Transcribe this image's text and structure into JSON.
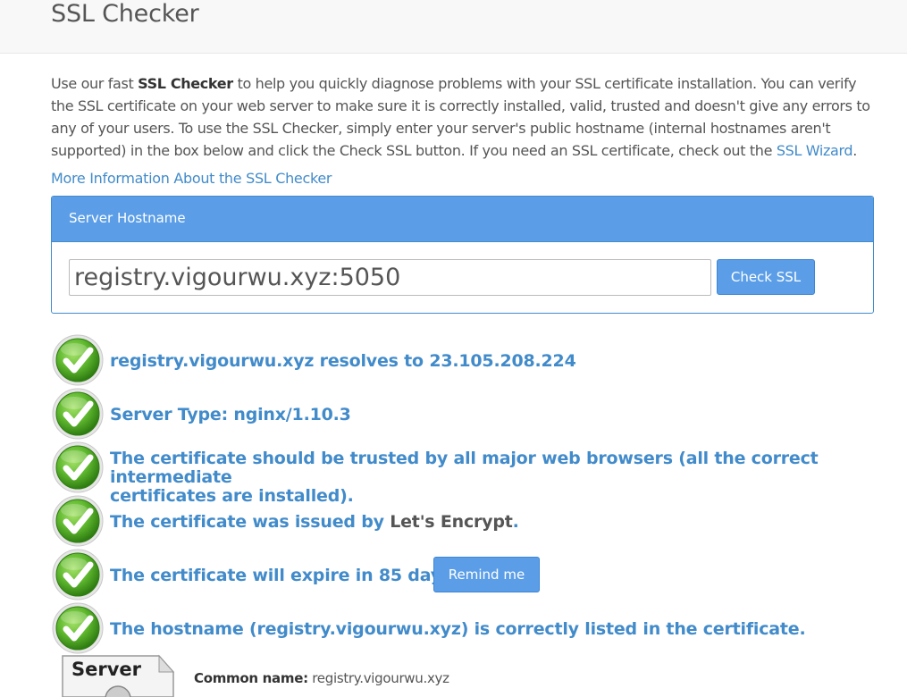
{
  "header": {
    "title": "SSL Checker"
  },
  "intro": {
    "before_bold": "Use our fast ",
    "bold": "SSL Checker",
    "after_bold": " to help you quickly diagnose problems with your SSL certificate installation. You can verify the SSL certificate on your web server to make sure it is correctly installed, valid, trusted and doesn't give any errors to any of your users. To use the SSL Checker, simply enter your server's public hostname (internal hostnames aren't supported) in the box below and click the Check SSL button. If you need an SSL certificate, check out the ",
    "link": "SSL Wizard",
    "end": "."
  },
  "more_info_link": "More Information About the SSL Checker",
  "form": {
    "heading": "Server Hostname",
    "hostname_value": "registry.vigourwu.xyz:5050",
    "check_button": "Check SSL"
  },
  "results": [
    {
      "text": "registry.vigourwu.xyz resolves to 23.105.208.224"
    },
    {
      "text": "Server Type: nginx/1.10.3"
    },
    {
      "line1": "The certificate should be trusted by all major web browsers (all the correct intermediate",
      "line2": "certificates are installed)."
    },
    {
      "prefix": "The certificate was issued by ",
      "issuer": "Let's Encrypt",
      "suffix": "."
    },
    {
      "text": "The certificate will expire in 85 days.",
      "button": "Remind me"
    },
    {
      "text": "The hostname (registry.vigourwu.xyz) is correctly listed in the certificate."
    }
  ],
  "server_image_label": "Server",
  "cert": {
    "common_name_label": "Common name:",
    "common_name_value": " registry.vigourwu.xyz"
  },
  "colors": {
    "accent": "#428bca",
    "panel_heading": "#5b9ee7",
    "check_green": "#5fb82e"
  },
  "icons": [
    "check-circle-icon",
    "server-certificate-icon"
  ]
}
